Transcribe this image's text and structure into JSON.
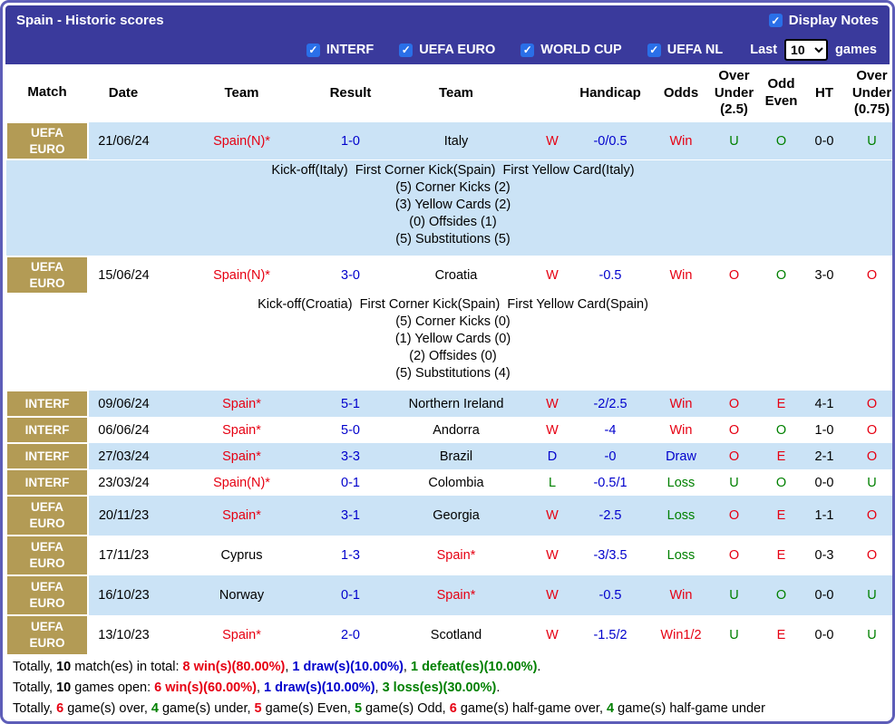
{
  "colors": {
    "bar": "#3a3a9c",
    "frame_border": "#5d5db8",
    "gold": "#b39b55",
    "row_blue": "#cbe3f6",
    "red": "#e60012",
    "blue": "#0000cc",
    "green": "#008000",
    "checkbox_blue": "#2a6fe8"
  },
  "header": {
    "title": "Spain - Historic scores",
    "display_notes": {
      "label": "Display Notes",
      "checked": true
    },
    "filters": [
      {
        "label": "INTERF",
        "checked": true
      },
      {
        "label": "UEFA EURO",
        "checked": true
      },
      {
        "label": "WORLD CUP",
        "checked": true
      },
      {
        "label": "UEFA NL",
        "checked": true
      }
    ],
    "last_label": "Last",
    "games_select": {
      "value": "10",
      "options": [
        "10"
      ]
    },
    "games_label": "games"
  },
  "table": {
    "columns": [
      "Match",
      "Date",
      "Team",
      "Result",
      "Team",
      "",
      "Handicap",
      "Odds",
      "Over Under (2.5)",
      "Odd Even",
      "HT",
      "Over Under (0.75)"
    ],
    "rows": [
      {
        "comp": "UEFA EURO",
        "date": "21/06/24",
        "home": "Spain(N)*",
        "home_red": true,
        "result": "1-0",
        "away": "Italy",
        "away_red": false,
        "wdl": "W",
        "handicap": "-0/0.5",
        "odds": "Win",
        "ou25": "U",
        "oe": "O",
        "ht": "0-0",
        "ou075": "U",
        "notes": [
          "Kick-off(Italy)  First Corner Kick(Spain)  First Yellow Card(Italy)",
          "(5) Corner Kicks (2)",
          "(3) Yellow Cards (2)",
          "(0) Offsides (1)",
          "(5) Substitutions (5)"
        ]
      },
      {
        "comp": "UEFA EURO",
        "date": "15/06/24",
        "home": "Spain(N)*",
        "home_red": true,
        "result": "3-0",
        "away": "Croatia",
        "away_red": false,
        "wdl": "W",
        "handicap": "-0.5",
        "odds": "Win",
        "ou25": "O",
        "oe": "O",
        "ht": "3-0",
        "ou075": "O",
        "notes": [
          "Kick-off(Croatia)  First Corner Kick(Spain)  First Yellow Card(Spain)",
          "(5) Corner Kicks (0)",
          "(1) Yellow Cards (0)",
          "(2) Offsides (0)",
          "(5) Substitutions (4)"
        ]
      },
      {
        "comp": "INTERF",
        "date": "09/06/24",
        "home": "Spain*",
        "home_red": true,
        "result": "5-1",
        "away": "Northern Ireland",
        "away_red": false,
        "wdl": "W",
        "handicap": "-2/2.5",
        "odds": "Win",
        "ou25": "O",
        "oe": "E",
        "ht": "4-1",
        "ou075": "O"
      },
      {
        "comp": "INTERF",
        "date": "06/06/24",
        "home": "Spain*",
        "home_red": true,
        "result": "5-0",
        "away": "Andorra",
        "away_red": false,
        "wdl": "W",
        "handicap": "-4",
        "odds": "Win",
        "ou25": "O",
        "oe": "O",
        "ht": "1-0",
        "ou075": "O"
      },
      {
        "comp": "INTERF",
        "date": "27/03/24",
        "home": "Spain*",
        "home_red": true,
        "result": "3-3",
        "away": "Brazil",
        "away_red": false,
        "wdl": "D",
        "handicap": "-0",
        "odds": "Draw",
        "ou25": "O",
        "oe": "E",
        "ht": "2-1",
        "ou075": "O"
      },
      {
        "comp": "INTERF",
        "date": "23/03/24",
        "home": "Spain(N)*",
        "home_red": true,
        "result": "0-1",
        "away": "Colombia",
        "away_red": false,
        "wdl": "L",
        "handicap": "-0.5/1",
        "odds": "Loss",
        "ou25": "U",
        "oe": "O",
        "ht": "0-0",
        "ou075": "U"
      },
      {
        "comp": "UEFA EURO",
        "date": "20/11/23",
        "home": "Spain*",
        "home_red": true,
        "result": "3-1",
        "away": "Georgia",
        "away_red": false,
        "wdl": "W",
        "handicap": "-2.5",
        "odds": "Loss",
        "ou25": "O",
        "oe": "E",
        "ht": "1-1",
        "ou075": "O"
      },
      {
        "comp": "UEFA EURO",
        "date": "17/11/23",
        "home": "Cyprus",
        "home_red": false,
        "result": "1-3",
        "away": "Spain*",
        "away_red": true,
        "wdl": "W",
        "handicap": "-3/3.5",
        "odds": "Loss",
        "ou25": "O",
        "oe": "E",
        "ht": "0-3",
        "ou075": "O"
      },
      {
        "comp": "UEFA EURO",
        "date": "16/10/23",
        "home": "Norway",
        "home_red": false,
        "result": "0-1",
        "away": "Spain*",
        "away_red": true,
        "wdl": "W",
        "handicap": "-0.5",
        "odds": "Win",
        "ou25": "U",
        "oe": "O",
        "ht": "0-0",
        "ou075": "U"
      },
      {
        "comp": "UEFA EURO",
        "date": "13/10/23",
        "home": "Spain*",
        "home_red": true,
        "result": "2-0",
        "away": "Scotland",
        "away_red": false,
        "wdl": "W",
        "handicap": "-1.5/2",
        "odds": "Win1/2",
        "ou25": "U",
        "oe": "E",
        "ht": "0-0",
        "ou075": "U"
      }
    ]
  },
  "footer_lines": [
    [
      {
        "t": "Totally, "
      },
      {
        "t": "10",
        "b": true
      },
      {
        "t": " match(es) in total: "
      },
      {
        "t": "8 win(s)(80.00%)",
        "c": "red",
        "b": true
      },
      {
        "t": ", "
      },
      {
        "t": "1 draw(s)(10.00%)",
        "c": "blue",
        "b": true
      },
      {
        "t": ", "
      },
      {
        "t": "1 defeat(es)(10.00%)",
        "c": "green",
        "b": true
      },
      {
        "t": "."
      }
    ],
    [
      {
        "t": "Totally, "
      },
      {
        "t": "10",
        "b": true
      },
      {
        "t": " games open: "
      },
      {
        "t": "6 win(s)(60.00%)",
        "c": "red",
        "b": true
      },
      {
        "t": ", "
      },
      {
        "t": "1 draw(s)(10.00%)",
        "c": "blue",
        "b": true
      },
      {
        "t": ", "
      },
      {
        "t": "3 loss(es)(30.00%)",
        "c": "green",
        "b": true
      },
      {
        "t": "."
      }
    ],
    [
      {
        "t": "Totally, "
      },
      {
        "t": "6",
        "c": "red",
        "b": true
      },
      {
        "t": " game(s) over, "
      },
      {
        "t": "4",
        "c": "green",
        "b": true
      },
      {
        "t": " game(s) under, "
      },
      {
        "t": "5",
        "c": "red",
        "b": true
      },
      {
        "t": " game(s) Even, "
      },
      {
        "t": "5",
        "c": "green",
        "b": true
      },
      {
        "t": " game(s) Odd, "
      },
      {
        "t": "6",
        "c": "red",
        "b": true
      },
      {
        "t": " game(s) half-game over, "
      },
      {
        "t": "4",
        "c": "green",
        "b": true
      },
      {
        "t": " game(s) half-game under"
      }
    ]
  ]
}
